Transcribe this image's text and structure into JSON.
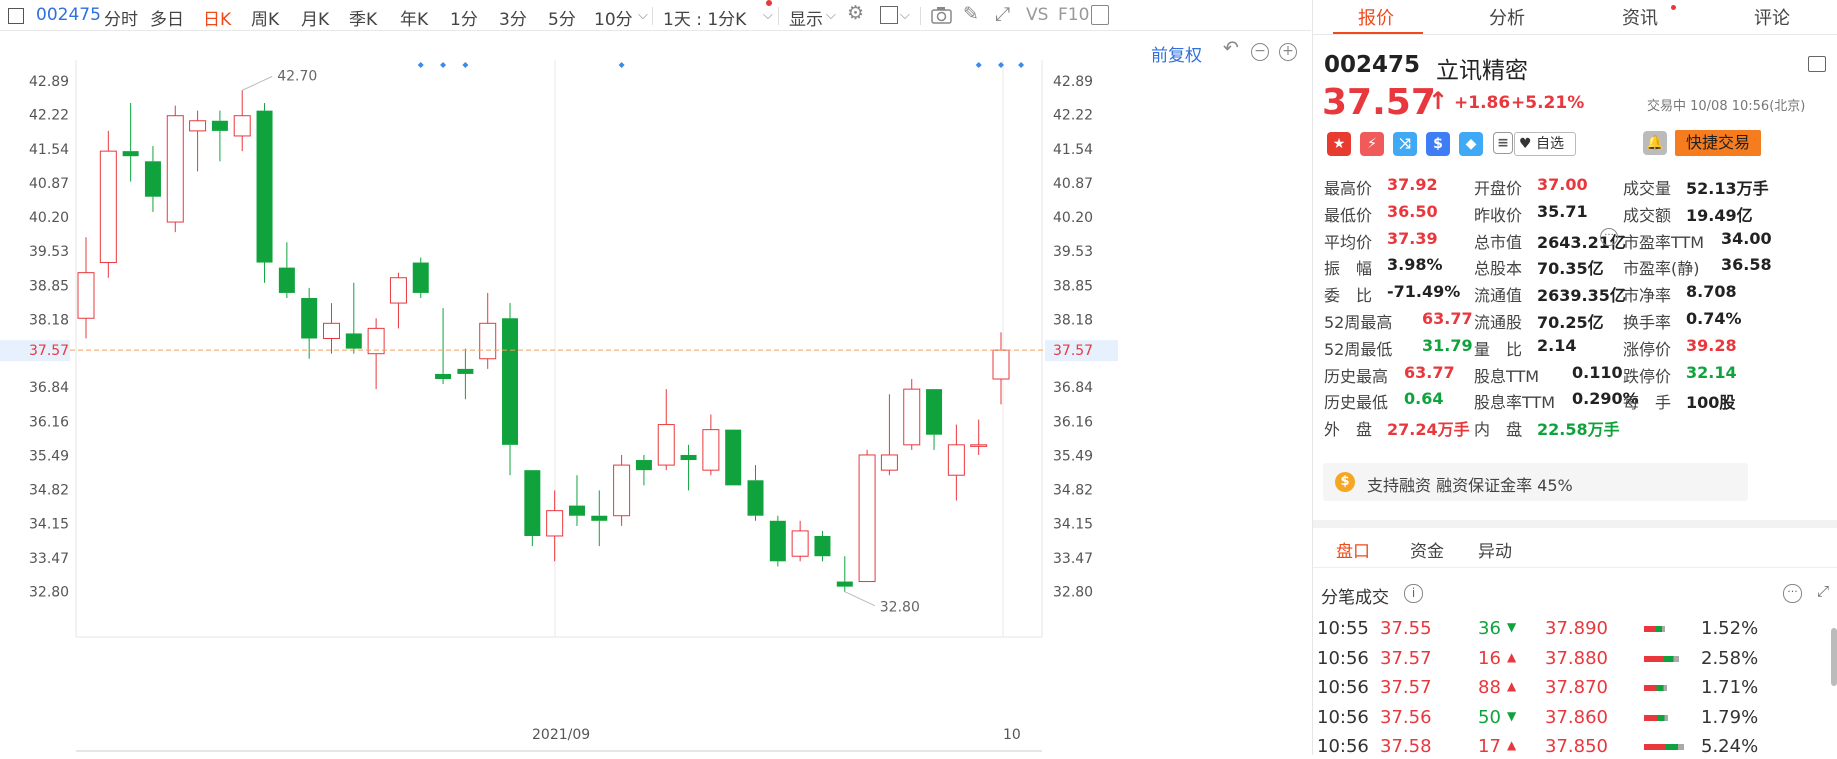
{
  "toolbar": {
    "code": "002475",
    "tabs": [
      "分时",
      "多日",
      "日K",
      "周K",
      "月K",
      "季K",
      "年K",
      "1分",
      "3分",
      "5分",
      "10分"
    ],
    "active_tab": "日K",
    "interval_select": "1天 : 1分K",
    "display_label": "显示",
    "vs_label": "VS",
    "f10_label": "F10"
  },
  "chart": {
    "adjust_label": "前复权",
    "price_ticks": [
      "42.89",
      "42.22",
      "41.54",
      "40.87",
      "40.20",
      "39.53",
      "38.85",
      "38.18",
      "37.57",
      "36.84",
      "36.16",
      "35.49",
      "34.82",
      "34.15",
      "33.47",
      "32.80"
    ],
    "current_price_tag": "37.57",
    "date_labels": [
      "2021/09",
      "10"
    ],
    "max_label": "42.70",
    "min_label": "32.80"
  },
  "chart_data": {
    "type": "candlestick",
    "ylim": [
      32.3,
      43.3
    ],
    "current_price": 37.57,
    "candles": [
      {
        "o": 38.2,
        "h": 39.8,
        "l": 37.8,
        "c": 39.1
      },
      {
        "o": 39.3,
        "h": 41.9,
        "l": 39.0,
        "c": 41.5
      },
      {
        "o": 41.5,
        "h": 42.45,
        "l": 40.9,
        "c": 41.4
      },
      {
        "o": 41.3,
        "h": 41.6,
        "l": 40.3,
        "c": 40.6
      },
      {
        "o": 40.1,
        "h": 42.4,
        "l": 39.9,
        "c": 42.2
      },
      {
        "o": 41.9,
        "h": 42.3,
        "l": 41.1,
        "c": 42.1
      },
      {
        "o": 42.1,
        "h": 42.3,
        "l": 41.3,
        "c": 41.9
      },
      {
        "o": 41.8,
        "h": 42.7,
        "l": 41.5,
        "c": 42.2
      },
      {
        "o": 42.3,
        "h": 42.45,
        "l": 38.9,
        "c": 39.3
      },
      {
        "o": 39.2,
        "h": 39.7,
        "l": 38.6,
        "c": 38.7
      },
      {
        "o": 38.6,
        "h": 38.8,
        "l": 37.4,
        "c": 37.8
      },
      {
        "o": 37.8,
        "h": 38.5,
        "l": 37.5,
        "c": 38.1
      },
      {
        "o": 37.9,
        "h": 38.9,
        "l": 37.5,
        "c": 37.6
      },
      {
        "o": 37.5,
        "h": 38.2,
        "l": 36.8,
        "c": 38.0
      },
      {
        "o": 38.5,
        "h": 39.1,
        "l": 38.0,
        "c": 39.0
      },
      {
        "o": 39.3,
        "h": 39.4,
        "l": 38.6,
        "c": 38.7
      },
      {
        "o": 37.1,
        "h": 38.4,
        "l": 36.9,
        "c": 37.0
      },
      {
        "o": 37.2,
        "h": 37.6,
        "l": 36.6,
        "c": 37.1
      },
      {
        "o": 37.4,
        "h": 38.7,
        "l": 37.2,
        "c": 38.1
      },
      {
        "o": 38.2,
        "h": 38.5,
        "l": 35.1,
        "c": 35.7
      },
      {
        "o": 35.2,
        "h": 35.2,
        "l": 33.7,
        "c": 33.9
      },
      {
        "o": 33.9,
        "h": 34.8,
        "l": 33.4,
        "c": 34.4
      },
      {
        "o": 34.5,
        "h": 35.1,
        "l": 34.1,
        "c": 34.3
      },
      {
        "o": 34.3,
        "h": 34.8,
        "l": 33.7,
        "c": 34.2
      },
      {
        "o": 34.3,
        "h": 35.5,
        "l": 34.1,
        "c": 35.3
      },
      {
        "o": 35.4,
        "h": 35.5,
        "l": 34.9,
        "c": 35.2
      },
      {
        "o": 35.3,
        "h": 36.8,
        "l": 35.2,
        "c": 36.1
      },
      {
        "o": 35.5,
        "h": 35.7,
        "l": 34.8,
        "c": 35.4
      },
      {
        "o": 35.2,
        "h": 36.3,
        "l": 35.1,
        "c": 36.0
      },
      {
        "o": 36.0,
        "h": 36.0,
        "l": 34.9,
        "c": 34.9
      },
      {
        "o": 35.0,
        "h": 35.3,
        "l": 34.2,
        "c": 34.3
      },
      {
        "o": 34.2,
        "h": 34.3,
        "l": 33.3,
        "c": 33.4
      },
      {
        "o": 33.5,
        "h": 34.2,
        "l": 33.4,
        "c": 34.0
      },
      {
        "o": 33.9,
        "h": 34.0,
        "l": 33.4,
        "c": 33.5
      },
      {
        "o": 33.0,
        "h": 33.5,
        "l": 32.8,
        "c": 32.9
      },
      {
        "o": 33.0,
        "h": 35.6,
        "l": 33.0,
        "c": 35.5
      },
      {
        "o": 35.2,
        "h": 36.7,
        "l": 35.1,
        "c": 35.5
      },
      {
        "o": 35.7,
        "h": 37.0,
        "l": 35.6,
        "c": 36.8
      },
      {
        "o": 36.8,
        "h": 36.8,
        "l": 35.6,
        "c": 35.9
      },
      {
        "o": 35.1,
        "h": 36.1,
        "l": 34.6,
        "c": 35.7
      },
      {
        "o": 35.7,
        "h": 36.2,
        "l": 35.5,
        "c": 35.7
      },
      {
        "o": 37.0,
        "h": 37.92,
        "l": 36.5,
        "c": 37.57
      }
    ]
  },
  "panel": {
    "tabs": [
      "报价",
      "分析",
      "资讯",
      "评论"
    ],
    "active_tab": "报价",
    "code": "002475",
    "name": "立讯精密",
    "price": "37.57",
    "arrow": "↑",
    "change": "+1.86",
    "change_pct": "+5.21%",
    "status": "交易中 10/08 10:56(北京)",
    "watch_label": "自选",
    "quick_trade": "快捷交易",
    "quote_grid": [
      [
        {
          "l": "最高价",
          "v": "37.92",
          "c": "red"
        },
        {
          "l": "开盘价",
          "v": "37.00",
          "c": "red"
        },
        {
          "l": "成交量",
          "v": "52.13万手",
          "c": "black"
        }
      ],
      [
        {
          "l": "最低价",
          "v": "36.50",
          "c": "red"
        },
        {
          "l": "昨收价",
          "v": "35.71",
          "c": "black"
        },
        {
          "l": "成交额",
          "v": "19.49亿",
          "c": "black"
        }
      ],
      [
        {
          "l": "平均价",
          "v": "37.39",
          "c": "red"
        },
        {
          "l": "总市值",
          "v": "2643.21亿",
          "c": "black"
        },
        {
          "l": "市盈率TTM",
          "v": "34.00",
          "c": "black"
        }
      ],
      [
        {
          "l": "振　幅",
          "v": "3.98%",
          "c": "black"
        },
        {
          "l": "总股本",
          "v": "70.35亿",
          "c": "black"
        },
        {
          "l": "市盈率(静)",
          "v": "36.58",
          "c": "black"
        }
      ],
      [
        {
          "l": "委　比",
          "v": "-71.49%",
          "c": "black"
        },
        {
          "l": "流通值",
          "v": "2639.35亿",
          "c": "black"
        },
        {
          "l": "市净率",
          "v": "8.708",
          "c": "black"
        }
      ],
      [
        {
          "l": "52周最高",
          "v": "63.77",
          "c": "red"
        },
        {
          "l": "流通股",
          "v": "70.25亿",
          "c": "black"
        },
        {
          "l": "换手率",
          "v": "0.74%",
          "c": "black"
        }
      ],
      [
        {
          "l": "52周最低",
          "v": "31.79",
          "c": "green"
        },
        {
          "l": "量　比",
          "v": "2.14",
          "c": "black"
        },
        {
          "l": "涨停价",
          "v": "39.28",
          "c": "red"
        }
      ],
      [
        {
          "l": "历史最高",
          "v": "63.77",
          "c": "red"
        },
        {
          "l": "股息TTM",
          "v": "0.110",
          "c": "black"
        },
        {
          "l": "跌停价",
          "v": "32.14",
          "c": "green"
        }
      ],
      [
        {
          "l": "历史最低",
          "v": "0.64",
          "c": "green"
        },
        {
          "l": "股息率TTM",
          "v": "0.290%",
          "c": "black"
        },
        {
          "l": "每　手",
          "v": "100股",
          "c": "black"
        }
      ],
      [
        {
          "l": "外　盘",
          "v": "27.24万手",
          "c": "red"
        },
        {
          "l": "内　盘",
          "v": "22.58万手",
          "c": "green"
        },
        {
          "l": "",
          "v": "",
          "c": "black"
        }
      ]
    ],
    "margin_text": "支持融资 融资保证金率 45%",
    "sub_tabs": [
      "盘口",
      "资金",
      "异动"
    ],
    "sub_active": "盘口",
    "trades_title": "分笔成交",
    "trades": [
      {
        "time": "10:55",
        "price": "37.55",
        "vol": "36",
        "dir": "down",
        "ref": "37.890",
        "pct": "1.52%",
        "bar": 0.52
      },
      {
        "time": "10:56",
        "price": "37.57",
        "vol": "16",
        "dir": "up",
        "ref": "37.880",
        "pct": "2.58%",
        "bar": 0.88
      },
      {
        "time": "10:56",
        "price": "37.57",
        "vol": "88",
        "dir": "up",
        "ref": "37.870",
        "pct": "1.71%",
        "bar": 0.58
      },
      {
        "time": "10:56",
        "price": "37.56",
        "vol": "50",
        "dir": "down",
        "ref": "37.860",
        "pct": "1.79%",
        "bar": 0.61
      },
      {
        "time": "10:56",
        "price": "37.58",
        "vol": "17",
        "dir": "up",
        "ref": "37.850",
        "pct": "5.24%",
        "bar": 1.0
      }
    ]
  },
  "colors": {
    "up": "#e8383d",
    "down": "#10a33d",
    "accent": "#f04a1a",
    "blue": "#2f6fdf"
  }
}
